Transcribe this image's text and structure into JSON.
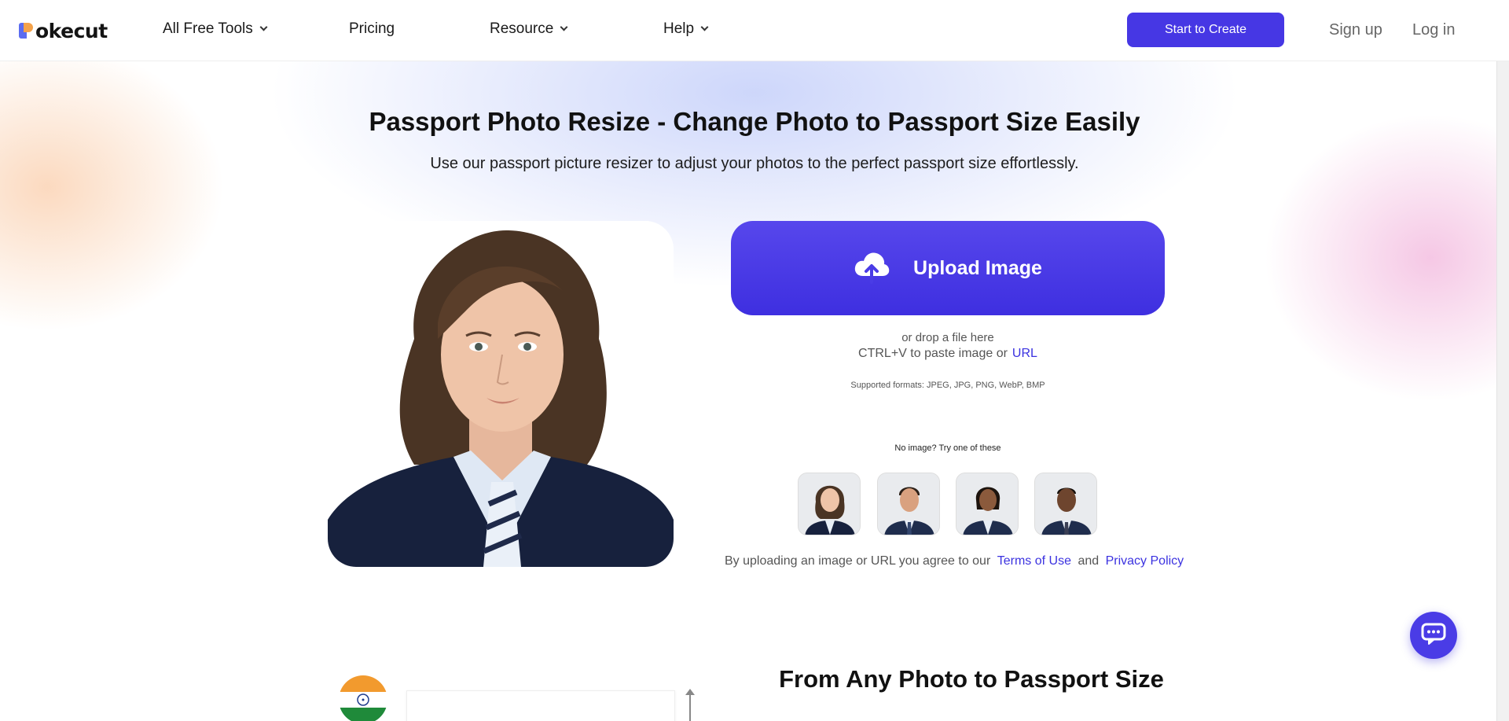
{
  "header": {
    "logo_text": "okecut",
    "nav": [
      {
        "label": "All Free Tools",
        "has_dropdown": true
      },
      {
        "label": "Pricing",
        "has_dropdown": false
      },
      {
        "label": "Resource",
        "has_dropdown": true
      },
      {
        "label": "Help",
        "has_dropdown": true
      }
    ],
    "cta_label": "Start to Create",
    "signup_label": "Sign up",
    "login_label": "Log in"
  },
  "hero": {
    "title": "Passport Photo Resize - Change Photo to Passport Size Easily",
    "subtitle": "Use our passport picture resizer to adjust your photos to the perfect passport size effortlessly."
  },
  "upload": {
    "button_label": "Upload Image",
    "drop_text": "or drop a file here",
    "paste_text": "CTRL+V to paste image or",
    "url_label": "URL",
    "formats_text": "Supported formats: JPEG, JPG, PNG, WebP, BMP",
    "no_image_text": "No image? Try one of these"
  },
  "terms": {
    "prefix": "By uploading an image or URL you agree to our",
    "terms_label": "Terms of Use",
    "and": "and",
    "privacy_label": "Privacy Policy"
  },
  "section2": {
    "title": "From Any Photo to Passport Size"
  },
  "colors": {
    "accent": "#4637e4",
    "link": "#3b32e0"
  },
  "icons": {
    "upload": "cloud-upload-icon",
    "chat": "chat-bubble-icon",
    "dropdown": "chevron-down-icon"
  }
}
